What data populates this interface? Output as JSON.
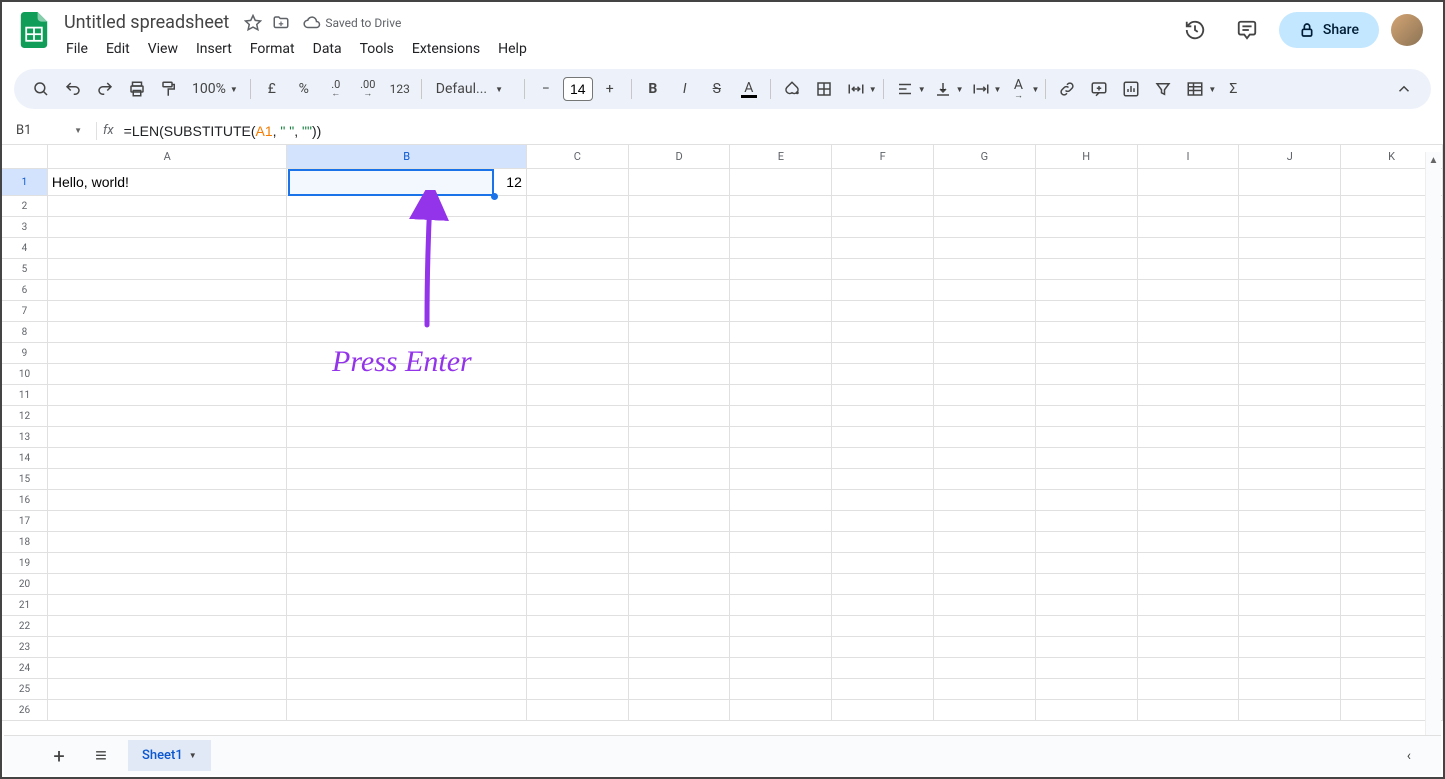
{
  "doc": {
    "title": "Untitled spreadsheet",
    "saved": "Saved to Drive"
  },
  "menu": {
    "file": "File",
    "edit": "Edit",
    "view": "View",
    "insert": "Insert",
    "format": "Format",
    "data": "Data",
    "tools": "Tools",
    "extensions": "Extensions",
    "help": "Help"
  },
  "share": {
    "label": "Share"
  },
  "toolbar": {
    "zoom": "100%",
    "currency": "£",
    "percent": "%",
    "dec_dec": ".0",
    "inc_dec": ".00",
    "num": "123",
    "font": "Defaul...",
    "font_size": "14"
  },
  "name_box": "B1",
  "formula": {
    "prefix": "=LEN(SUBSTITUTE(",
    "ref": "A1",
    "mid": ", ",
    "s1": "\" \"",
    "mid2": ", ",
    "s2": "\"\"",
    "suffix": "))"
  },
  "columns": [
    "A",
    "B",
    "C",
    "D",
    "E",
    "F",
    "G",
    "H",
    "I",
    "J",
    "K"
  ],
  "rows": 26,
  "cells": {
    "A1": "Hello, world!",
    "B1": "12"
  },
  "selected": {
    "col": "B",
    "row": 1
  },
  "sheet": {
    "name": "Sheet1"
  },
  "annotation": {
    "text": "Press Enter"
  }
}
